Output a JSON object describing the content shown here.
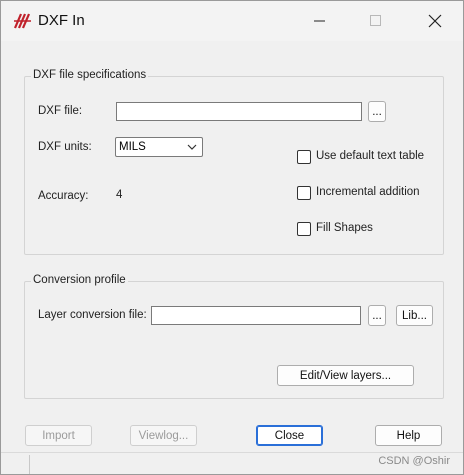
{
  "window": {
    "title": "DXF In",
    "app_icon": "allegro-icon"
  },
  "dxf_specs": {
    "group_label": "DXF file specifications",
    "file_label": "DXF file:",
    "file_value": "",
    "browse_label": "...",
    "units_label": "DXF units:",
    "units_value": "MILS",
    "accuracy_label": "Accuracy:",
    "accuracy_value": "4",
    "checkboxes": [
      {
        "label": "Use default text table",
        "checked": false
      },
      {
        "label": "Incremental addition",
        "checked": false
      },
      {
        "label": "Fill Shapes",
        "checked": false
      }
    ]
  },
  "conversion_profile": {
    "group_label": "Conversion profile",
    "layer_file_label": "Layer conversion file:",
    "layer_file_value": "",
    "browse_label": "...",
    "lib_label": "Lib...",
    "edit_view_label": "Edit/View layers..."
  },
  "buttons": {
    "import_label": "Import",
    "viewlog_label": "Viewlog...",
    "close_label": "Close",
    "help_label": "Help"
  },
  "watermark": "CSDN @Oshir"
}
